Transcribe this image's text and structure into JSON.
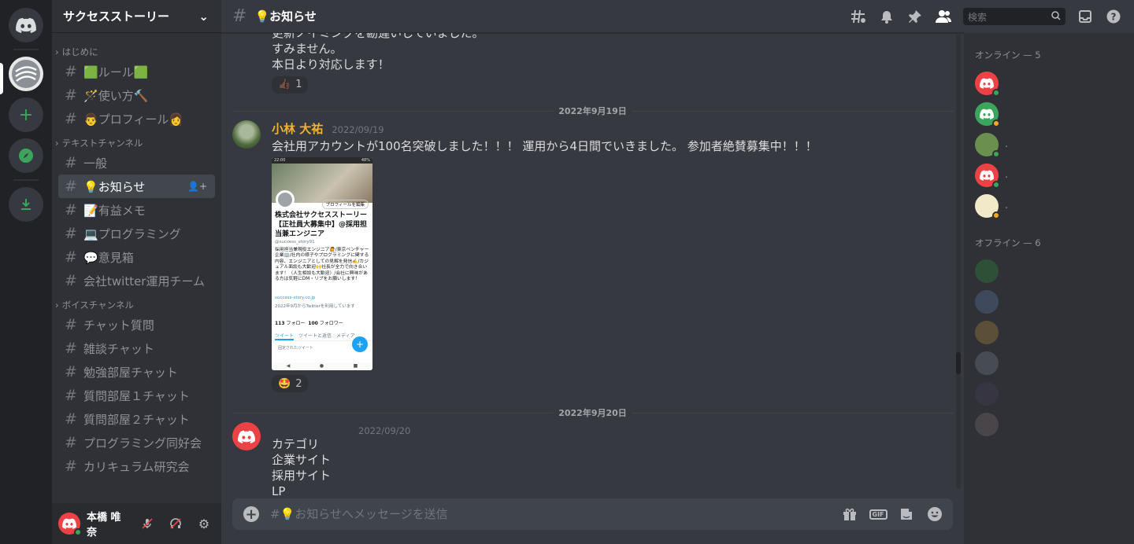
{
  "server": {
    "name": "サクセスストーリー"
  },
  "categories": {
    "intro": "はじめに",
    "text": "テキストチャンネル",
    "voice": "ボイスチャンネル"
  },
  "channels": {
    "intro": [
      {
        "emoji": "🟩",
        "label": "ルール",
        "suffix": "🟩"
      },
      {
        "emoji": "🪄",
        "label": "使い方",
        "suffix": "🔨"
      },
      {
        "emoji": "👨",
        "label": "プロフィール",
        "suffix": "👩"
      }
    ],
    "text": [
      {
        "emoji": "",
        "label": "一般"
      },
      {
        "emoji": "💡",
        "label": "お知らせ",
        "active": true
      },
      {
        "emoji": "📝",
        "label": "有益メモ"
      },
      {
        "emoji": "💻",
        "label": "プログラミング"
      },
      {
        "emoji": "💬",
        "label": "意見箱"
      },
      {
        "emoji": "",
        "label": "会社twitter運用チーム"
      }
    ],
    "voice": [
      {
        "label": "チャット質問"
      },
      {
        "label": "雑談チャット"
      },
      {
        "label": "勉強部屋チャット"
      },
      {
        "label": "質問部屋１チャット"
      },
      {
        "label": "質問部屋２チャット"
      },
      {
        "label": "プログラミング同好会"
      },
      {
        "label": "カリキュラム研究会"
      }
    ]
  },
  "user": {
    "name": "本橋 唯奈"
  },
  "header": {
    "channel_title": "💡お知らせ",
    "search_placeholder": "検索"
  },
  "messages": {
    "prev_lines": [
      "更新ノイミングを勘違いしていました。",
      "すみません。",
      "本日より対応します！"
    ],
    "prev_reaction": {
      "emoji": "👍🏿",
      "count": "1"
    },
    "date1": "2022年9月19日",
    "msg1": {
      "author": "小林 大祐",
      "timestamp": "2022/09/19",
      "text": "会社用アカウントが100名突破しました！！！ 運用から4日間でいきました。 参加者絶賛募集中！！！",
      "reaction": {
        "emoji": "🤩",
        "count": "2"
      }
    },
    "date2": "2022年9月20日",
    "msg2": {
      "timestamp": "2022/09/20",
      "lines": [
        "カテゴリ",
        "企業サイト",
        "採用サイト",
        "LP"
      ]
    }
  },
  "tweet": {
    "status_time": "22:00",
    "status_batt": "48%",
    "edit_label": "プロフィールを編集",
    "name": "株式会社サクセスストーリー【正社員大募集中】@採用担当兼エンジニア",
    "handle": "@success_story91",
    "bio": "採用担当兼現役エンジニア🙋/東京ベンチャー企業🏢/社内の様子やプログラミングに関する内容、エンジニアとしての見解を発信✍️/カジュアル面談も大歓迎🙌社長が全力で向き合います！（人生相談も大歓迎）/会社に興味がある方は気軽にDM・リプをお願いします！",
    "link": "success-story.co.jp",
    "joined": "2022年9月からTwitterを利用しています",
    "following": "113",
    "following_label": "フォロー",
    "followers": "100",
    "followers_label": "フォロワー",
    "tabs": [
      "ツイート",
      "ツイートと返信",
      "メディア"
    ],
    "pinned": "固定されたツイート",
    "fab": "+"
  },
  "composer": {
    "placeholder": "#💡お知らせへメッセージを送信",
    "gif_label": "GIF"
  },
  "members": {
    "online_label": "オンライン — 5",
    "offline_label": "オフライン — 6",
    "online": [
      {
        "color": "#ed4245",
        "status": "#3ba55d",
        "name": ""
      },
      {
        "color": "#3ba55d",
        "status": "#faa81a",
        "name": ""
      },
      {
        "color": "#6a8f4e",
        "status": "#3ba55d",
        "name": "."
      },
      {
        "color": "#ed4245",
        "status": "#3ba55d",
        "name": "."
      },
      {
        "color": "#f1e9c8",
        "status": "#faa81a",
        "name": "."
      }
    ],
    "offline": [
      {
        "color": "#2e8b3a"
      },
      {
        "color": "#5b7aa0"
      },
      {
        "color": "#b08a3a"
      },
      {
        "color": "#747f8d"
      },
      {
        "color": "#4a3f5c"
      },
      {
        "color": "#7a6e6a"
      }
    ]
  }
}
